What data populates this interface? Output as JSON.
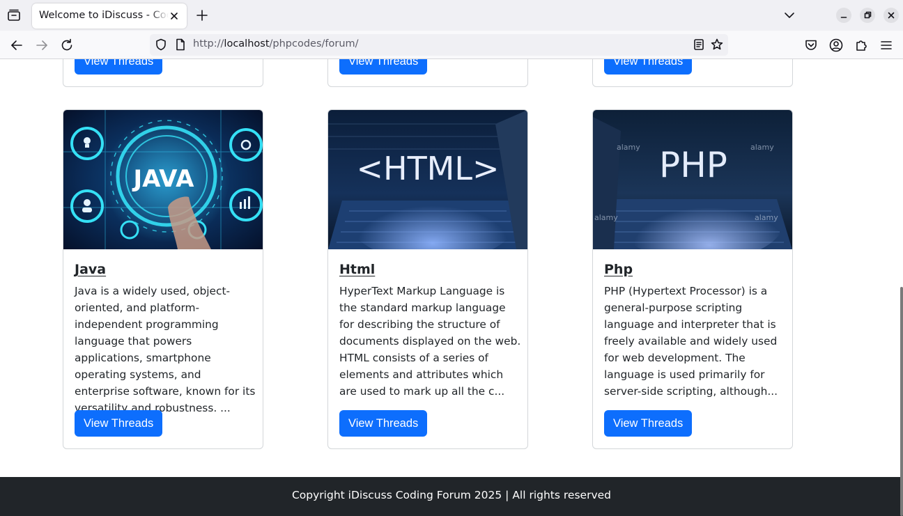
{
  "browser": {
    "tab_title": "Welcome to iDiscuss - Coding Forum",
    "url_prefix": "http://",
    "url_host": "localhost",
    "url_path": "/phpcodes/forum/",
    "icons": {
      "tab_list": "tab-list-icon",
      "close_tab": "close-icon",
      "new_tab": "plus-icon",
      "overflow": "chevron-down-icon",
      "back": "arrow-left-icon",
      "forward": "arrow-right-icon",
      "reload": "reload-icon",
      "shield": "shield-icon",
      "page": "page-icon",
      "reader": "reader-view-icon",
      "bookmark": "star-icon",
      "pocket": "pocket-icon",
      "account": "account-icon",
      "extensions": "puzzle-icon",
      "menu": "hamburger-menu-icon"
    }
  },
  "categories_top_row": [
    {
      "button_label": "View Threads"
    },
    {
      "button_label": "View Threads"
    },
    {
      "button_label": "View Threads"
    }
  ],
  "categories": [
    {
      "title": "Java",
      "image_text": "JAVA",
      "description": "Java is a widely used, object-oriented, and platform-independent programming language that powers applications, smartphone operating systems, and enterprise software, known for its versatility and robustness. ...",
      "button_label": "View Threads"
    },
    {
      "title": "Html",
      "image_text": "<HTML>",
      "description": "HyperText Markup Language is the standard markup language for describing the structure of documents displayed on the web. HTML consists of a series of elements and attributes which are used to mark up all the c...",
      "button_label": "View Threads"
    },
    {
      "title": "Php",
      "image_text": "PHP",
      "watermark": "alamy",
      "description": "PHP (Hypertext Processor) is a general-purpose scripting language and interpreter that is freely available and widely used for web development. The language is used primarily for server-side scripting, although...",
      "button_label": "View Threads"
    }
  ],
  "footer": {
    "text": "Copyright iDiscuss Coding Forum 2025 | All rights reserved"
  },
  "colors": {
    "primary": "#0d6efd",
    "footer_bg": "#212529",
    "text": "#212529"
  }
}
